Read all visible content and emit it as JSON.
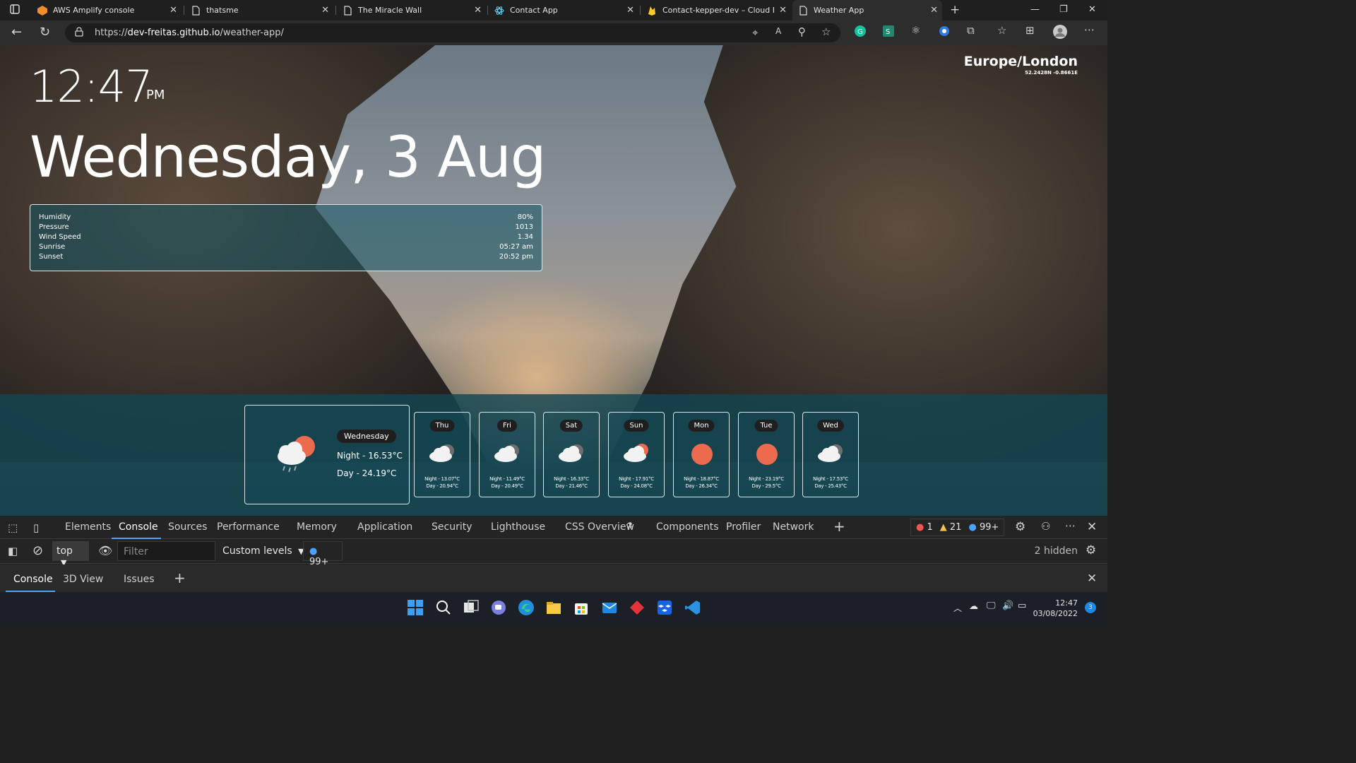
{
  "browser": {
    "tabs": [
      {
        "title": "AWS Amplify console",
        "icon": "aws-icon"
      },
      {
        "title": "thatsme",
        "icon": "page-icon"
      },
      {
        "title": "The Miracle Wall",
        "icon": "page-icon"
      },
      {
        "title": "Contact App",
        "icon": "react-icon"
      },
      {
        "title": "Contact-kepper-dev – Cloud Fire",
        "icon": "firebase-icon"
      },
      {
        "title": "Weather App",
        "icon": "page-icon"
      }
    ],
    "url_prefix": "https://",
    "url_host": "dev-freitas.github.io",
    "url_path": "/weather-app/"
  },
  "weather": {
    "time": "12:47",
    "ampm": "PM",
    "date": "Wednesday, 3 Aug",
    "timezone": "Europe/London",
    "coords": "52.2428N -0.8661E",
    "details": [
      {
        "label": "Humidity",
        "value": "80%"
      },
      {
        "label": "Pressure",
        "value": "1013"
      },
      {
        "label": "Wind Speed",
        "value": "1.34"
      },
      {
        "label": "Sunrise",
        "value": "05:27 am"
      },
      {
        "label": "Sunset",
        "value": "20:52 pm"
      }
    ],
    "today": {
      "day": "Wednesday",
      "night": "Night - 16.53°C",
      "day_temp": "Day - 24.19°C",
      "icon": "rain-cloud-sun-icon"
    },
    "forecast": [
      {
        "day": "Thu",
        "night": "Night - 13.07°C",
        "day_temp": "Day - 20.94°C",
        "icon": "cloud-icon"
      },
      {
        "day": "Fri",
        "night": "Night - 11.49°C",
        "day_temp": "Day - 20.49°C",
        "icon": "cloud-icon"
      },
      {
        "day": "Sat",
        "night": "Night - 16.33°C",
        "day_temp": "Day - 21.46°C",
        "icon": "cloud-icon"
      },
      {
        "day": "Sun",
        "night": "Night - 17.91°C",
        "day_temp": "Day - 24.08°C",
        "icon": "cloud-sun-icon"
      },
      {
        "day": "Mon",
        "night": "Night - 18.87°C",
        "day_temp": "Day - 26.34°C",
        "icon": "sun-icon"
      },
      {
        "day": "Tue",
        "night": "Night - 23.19°C",
        "day_temp": "Day - 29.5°C",
        "icon": "sun-icon"
      },
      {
        "day": "Wed",
        "night": "Night - 17.53°C",
        "day_temp": "Day - 25.43°C",
        "icon": "cloud-icon"
      }
    ]
  },
  "devtools": {
    "tabs": [
      "Elements",
      "Console",
      "Sources",
      "Performance",
      "Memory",
      "Application",
      "Security",
      "Lighthouse",
      "CSS Overview",
      "Components",
      "Profiler",
      "Network"
    ],
    "active_tab": "Console",
    "errors": "1",
    "warnings": "21",
    "messages": "99+",
    "context": "top",
    "filter_placeholder": "Filter",
    "levels": "Custom levels",
    "level_count": "99+",
    "hidden": "2 hidden",
    "drawer_tabs": [
      "Console",
      "3D View",
      "Issues"
    ]
  },
  "taskbar": {
    "time": "12:47",
    "date": "03/08/2022",
    "notifications": "3"
  },
  "colors": {
    "accent": "#4aa3ff",
    "sun": "#ec6a4e",
    "panel": "#145564"
  }
}
